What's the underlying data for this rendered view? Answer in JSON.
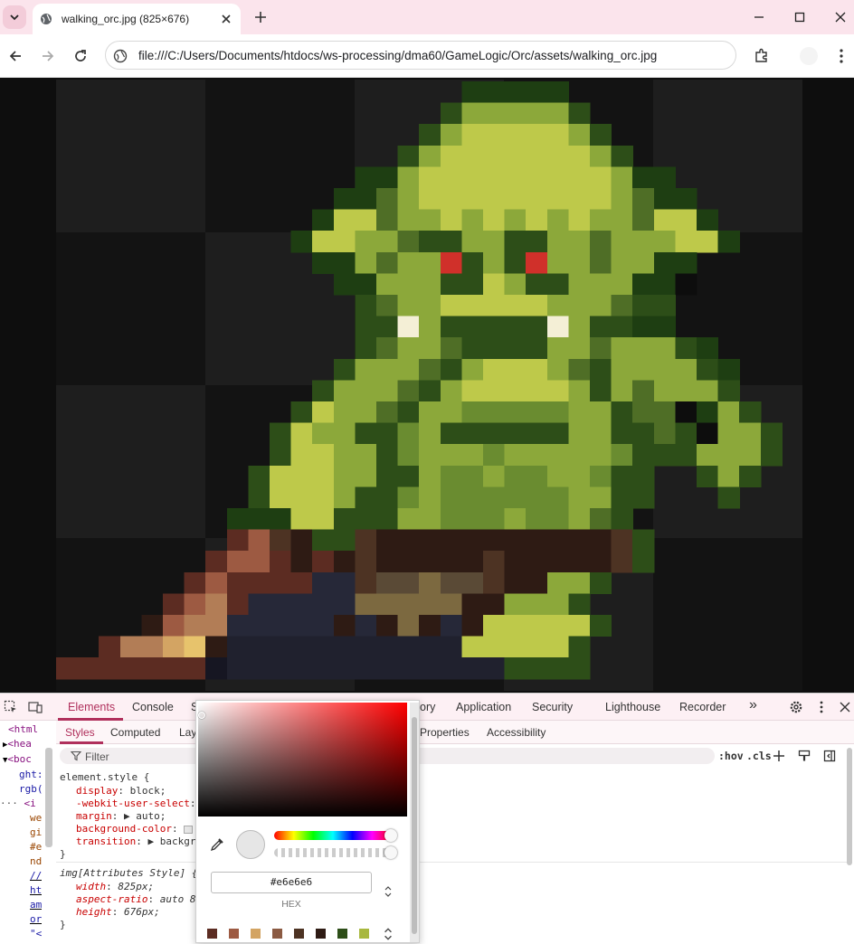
{
  "browser": {
    "tab_title": "walking_orc.jpg (825×676)",
    "url": "file:///C:/Users/Documents/htdocs/ws-processing/dma60/GameLogic/Orc/assets/walking_orc.jpg"
  },
  "image": {
    "alt": "walking_orc.jpg",
    "background_checker_colors": [
      "#1e1e1e",
      "#131313",
      "#161616",
      "#252525"
    ],
    "palette": {
      "O": "#1e3e12",
      "D": "#2d4e18",
      "M": "#4f6e26",
      "G": "#6a8c30",
      "L": "#8ca83a",
      "Y": "#bec94a",
      "R": "#d0302a",
      "W": "#f4efd6",
      "B": "#2e1b14",
      "N": "#4d3323",
      "K": "#5c2c22",
      "C": "#9d5a42",
      "P": "#b27d56",
      "S": "#d3a463",
      "T": "#e7c36c",
      "E": "#7c6940",
      "H": "#5a4a36",
      "J": "#20212e",
      "Q": "#161622",
      "V": "#262838",
      "Z": "#0d0d0d"
    }
  },
  "devtools": {
    "tabs": [
      "Elements",
      "Console",
      "S",
      "ory",
      "Application",
      "Security",
      "Lighthouse",
      "Recorder"
    ],
    "more_tabs": "»",
    "subtabs": [
      "Styles",
      "Computed",
      "Lay",
      "Properties",
      "Accessibility"
    ],
    "filter_placeholder": "Filter",
    "hov": ":hov",
    "cls": ".cls",
    "elements_lines": [
      "<html",
      "<hea",
      "<boc",
      "ght:",
      "rgb(",
      "<i",
      "we",
      "gi",
      "#e",
      "nd",
      "//",
      "ht",
      "am",
      "or",
      "\"<"
    ],
    "rules": {
      "element_style_selector": "element.style {",
      "props": [
        {
          "name": "display",
          "value": "block;"
        },
        {
          "name": "-webkit-user-select",
          "value": ""
        },
        {
          "name": "margin",
          "value": "▶ auto;"
        },
        {
          "name": "background-color",
          "value": ""
        },
        {
          "name": "transition",
          "value": "▶ backgro"
        }
      ],
      "close": "}",
      "img_selector": "img[Attributes Style] {",
      "img_props": [
        {
          "name": "width",
          "value": "825px;"
        },
        {
          "name": "aspect-ratio",
          "value": "auto 8"
        },
        {
          "name": "height",
          "value": "676px;"
        }
      ]
    }
  },
  "color_picker": {
    "hex_value": "#e6e6e6",
    "format_label": "HEX",
    "swatch_color": "#e6e6e6",
    "palette": [
      "#5c2c22",
      "#9d5a42",
      "#d3a463",
      "#8b5a42",
      "#4d3323",
      "#2e1b14",
      "#2d4e18",
      "#a8b83e"
    ]
  }
}
